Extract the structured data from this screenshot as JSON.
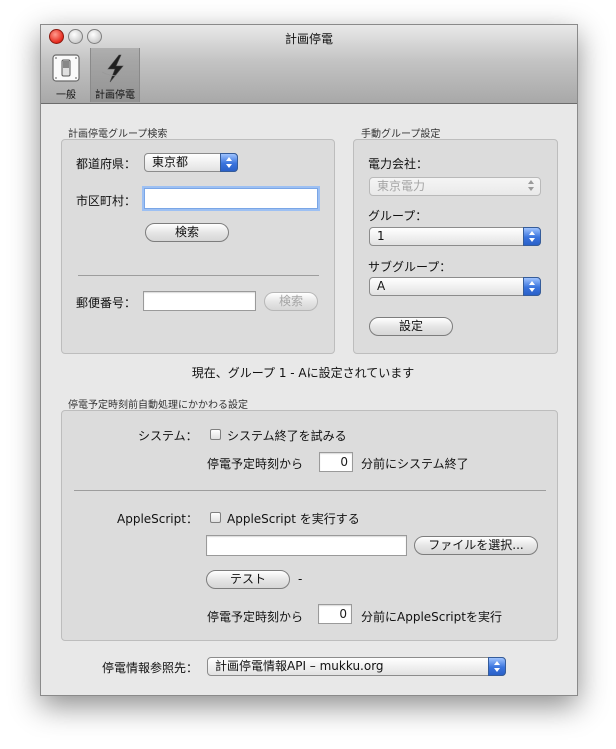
{
  "window": {
    "title": "計画停電"
  },
  "toolbar": {
    "items": [
      {
        "label": "一般",
        "icon": "switch-icon",
        "selected": false
      },
      {
        "label": "計画停電",
        "icon": "lightning-bolt-icon",
        "selected": true
      }
    ]
  },
  "group_search": {
    "heading": "計画停電グループ検索",
    "prefecture_label": "都道府県：",
    "prefecture_value": "東京都",
    "city_label": "市区町村：",
    "city_value": "",
    "search_button": "検索",
    "postal_label": "郵便番号：",
    "postal_value": "",
    "postal_search_button": "検索"
  },
  "manual_setting": {
    "heading": "手動グループ設定",
    "company_label": "電力会社：",
    "company_value": "東京電力",
    "group_label": "グループ：",
    "group_value": "1",
    "subgroup_label": "サブグループ：",
    "subgroup_value": "A",
    "set_button": "設定"
  },
  "status_text": "現在、グループ 1 - Aに設定されています",
  "auto_process": {
    "heading": "停電予定時刻前自動処理にかかわる設定",
    "system_label": "システム：",
    "system_checkbox_label": "システム終了を試みる",
    "system_checked": false,
    "system_before_label": "停電予定時刻から",
    "system_minutes": "0",
    "system_after_label": "分前にシステム終了",
    "applescript_label": "AppleScript：",
    "applescript_checkbox_label": "AppleScript を実行する",
    "applescript_checked": false,
    "applescript_path": "",
    "choose_file_button": "ファイルを選択...",
    "test_button": "テスト",
    "test_result": "-",
    "as_before_label": "停電予定時刻から",
    "as_minutes": "0",
    "as_after_label": "分前にAppleScriptを実行"
  },
  "source": {
    "label": "停電情報参照先：",
    "value": "計画停電情報API – mukku.org"
  },
  "colors": {
    "accent": "#3a74dd",
    "close": "#e5281c",
    "focus_ring": "#9dc0f3"
  }
}
